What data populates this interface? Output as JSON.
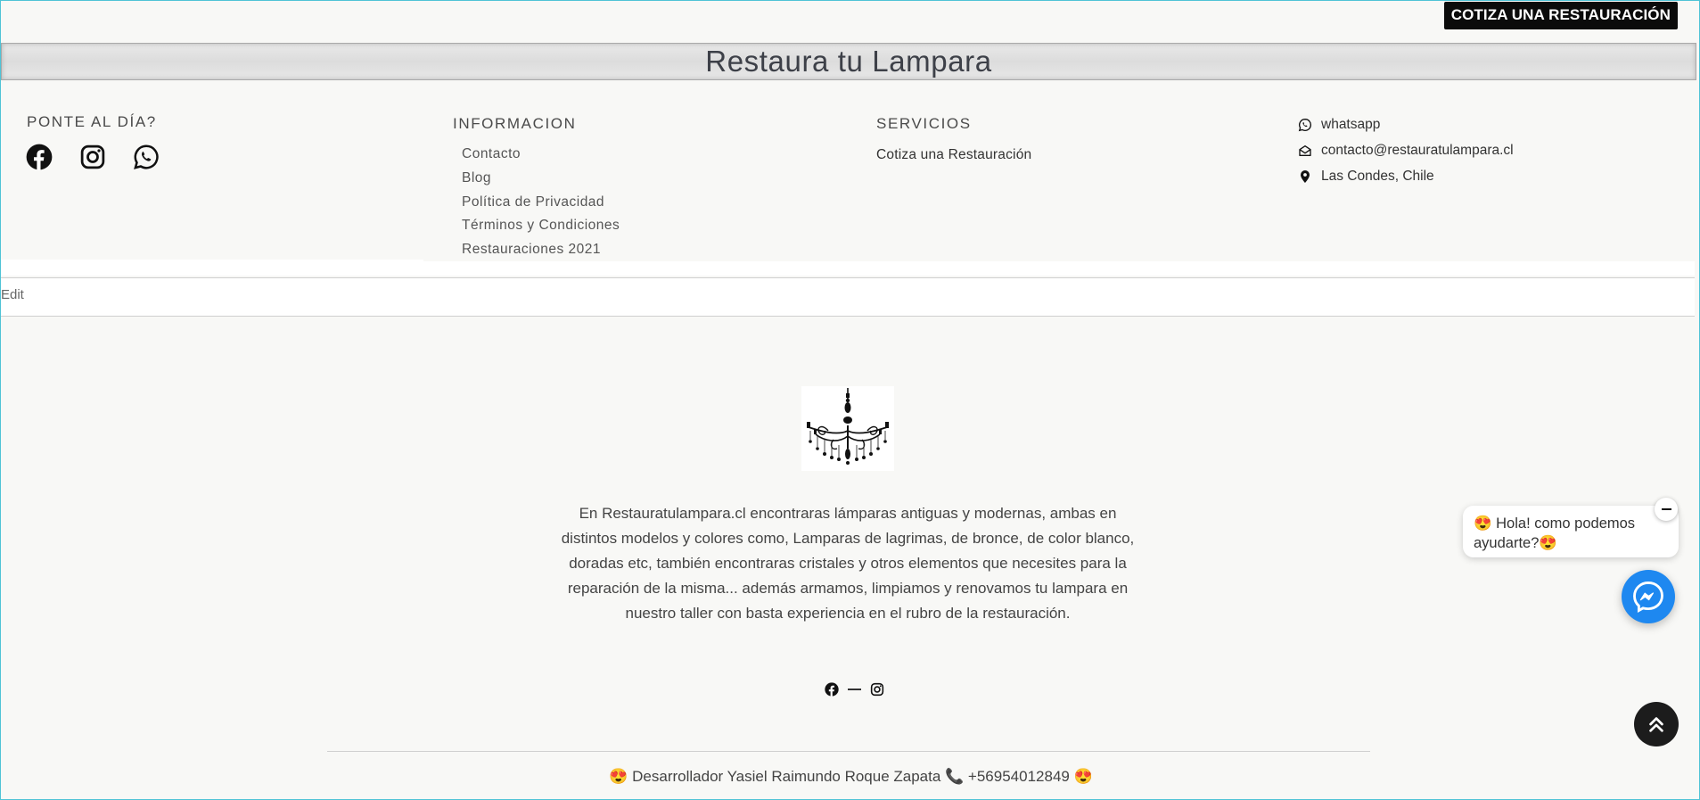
{
  "header": {
    "cta_label": "COTIZA UNA RESTAURACIÓN"
  },
  "title_bar": {
    "title": "Restaura tu Lampara"
  },
  "footer_columns": {
    "social": {
      "heading": "PONTE AL DÍA?",
      "icons": [
        "facebook-icon",
        "instagram-icon",
        "whatsapp-icon"
      ]
    },
    "info": {
      "heading": "INFORMACION",
      "links": [
        "Contacto",
        "Blog",
        "Política de Privacidad",
        "Términos y Condiciones",
        "Restauraciones 2021"
      ]
    },
    "services": {
      "heading": "SERVICIOS",
      "links": [
        "Cotiza una Restauración"
      ]
    },
    "contact": {
      "whatsapp": "whatsapp",
      "email": "contacto@restauratulampara.cl",
      "location": "Las Condes, Chile"
    }
  },
  "edit": {
    "label": "Edit"
  },
  "about": {
    "logo_icon": "chandelier-icon",
    "description": "En Restauratulampara.cl encontraras lámparas antiguas y modernas, ambas en distintos modelos y colores como, Lamparas de lagrimas, de bronce, de color blanco, doradas etc, también encontraras cristales y otros elementos que necesites para la reparación de la misma... además armamos, limpiamos y renovamos tu lampara en nuestro taller con basta experiencia en el rubro de la restauración.",
    "social_icons": [
      "facebook-icon",
      "instagram-icon"
    ]
  },
  "credit": {
    "text": "😍 Desarrollador Yasiel Raimundo Roque Zapata 📞 +56954012849 😍"
  },
  "chat": {
    "greeting": "😍 Hola! como podemos ayudarte?😍",
    "accent": "#1e88f0"
  }
}
